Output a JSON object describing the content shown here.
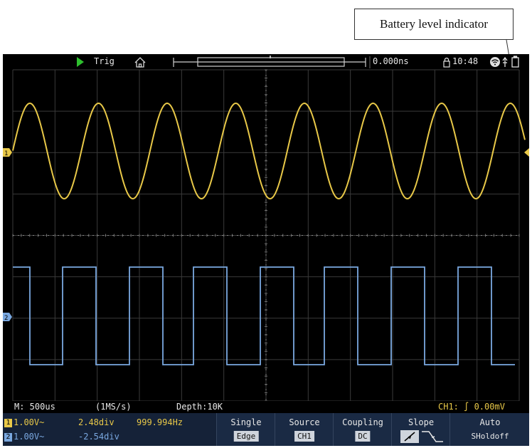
{
  "callout": {
    "label": "Battery level indicator"
  },
  "topbar": {
    "trigger_status": "Trig",
    "horizontal_position": "0.000ns",
    "time": "10:48"
  },
  "status": {
    "timebase": "M: 500us",
    "sample_rate": "(1MS/s)",
    "depth": "Depth:10K",
    "trigger_level": "CH1: ∫ 0.00mV"
  },
  "channels": [
    {
      "id": "1",
      "scale": "1.00V~",
      "position": "2.48div",
      "frequency": "999.994Hz",
      "color": "#e8c848"
    },
    {
      "id": "2",
      "scale": "1.00V~",
      "position": "-2.54div",
      "frequency": "",
      "color": "#7aa8e0"
    }
  ],
  "menu": {
    "single": {
      "label": "Single",
      "value": "Edge"
    },
    "source": {
      "label": "Source",
      "value": "CH1"
    },
    "coupling": {
      "label": "Coupling",
      "value": "DC"
    },
    "slope": {
      "label": "Slope"
    },
    "auto": {
      "label": "Auto",
      "value": "SHoldoff"
    }
  },
  "colors": {
    "ch1": "#e8c848",
    "ch2": "#7aa8e0",
    "trigger_run": "#2ec02e",
    "background": "#000000"
  }
}
